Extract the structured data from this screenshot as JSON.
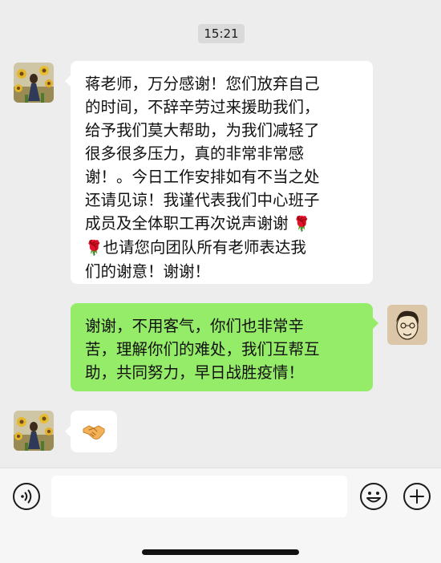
{
  "status": {
    "time": "15:21"
  },
  "messages": [
    {
      "side": "left",
      "type": "text",
      "lines": [
        "蒋老师，万分感谢！您们放弃自己",
        "的时间，不辞辛劳过来援助我们，",
        "给予我们莫大帮助，为我们减轻了",
        "很多很多压力，真的非常非常感",
        "谢！。今日工作安排如有不当之处",
        "还请见谅！我谨代表我们中心班子",
        "成员及全体职工再次说声谢谢",
        "也请您向团队所有老师表达我",
        "们的谢意！谢谢！"
      ],
      "emoji": "rose"
    },
    {
      "side": "right",
      "type": "text",
      "lines": [
        "谢谢，不用客气，你们也非常辛",
        "苦，理解你们的难处，我们互帮互",
        "助，共同努力，早日战胜疫情！"
      ]
    },
    {
      "side": "left",
      "type": "emoji",
      "emoji": "handshake"
    }
  ],
  "input_bar": {
    "text_value": "",
    "voice_icon": "voice-icon",
    "emoji_icon": "emoji-icon",
    "plus_icon": "plus-icon"
  },
  "colors": {
    "chat_background": "#ededed",
    "incoming_bubble": "#ffffff",
    "outgoing_bubble": "#95ec69",
    "timestamp_pill": "#dadada"
  }
}
